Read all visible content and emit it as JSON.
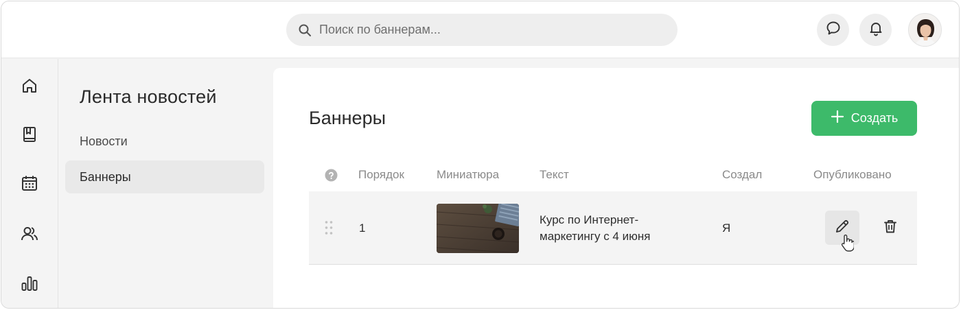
{
  "search": {
    "placeholder": "Поиск по баннерам..."
  },
  "sidebar": {
    "icons": [
      "home-icon",
      "book-icon",
      "calendar-icon",
      "users-icon",
      "bar-chart-icon"
    ]
  },
  "subnav": {
    "title": "Лента новостей",
    "items": [
      {
        "label": "Новости",
        "active": false
      },
      {
        "label": "Баннеры",
        "active": true
      }
    ]
  },
  "main": {
    "title": "Баннеры",
    "create_label": "Создать",
    "columns": [
      "Порядок",
      "Миниатюра",
      "Текст",
      "Создал",
      "Опубликовано"
    ],
    "rows": [
      {
        "order": "1",
        "text": "Курс по Интернет-маркетингу с 4 июня",
        "author": "Я"
      }
    ]
  },
  "colors": {
    "accent": "#3dba6a",
    "background": "#f4f4f4"
  }
}
